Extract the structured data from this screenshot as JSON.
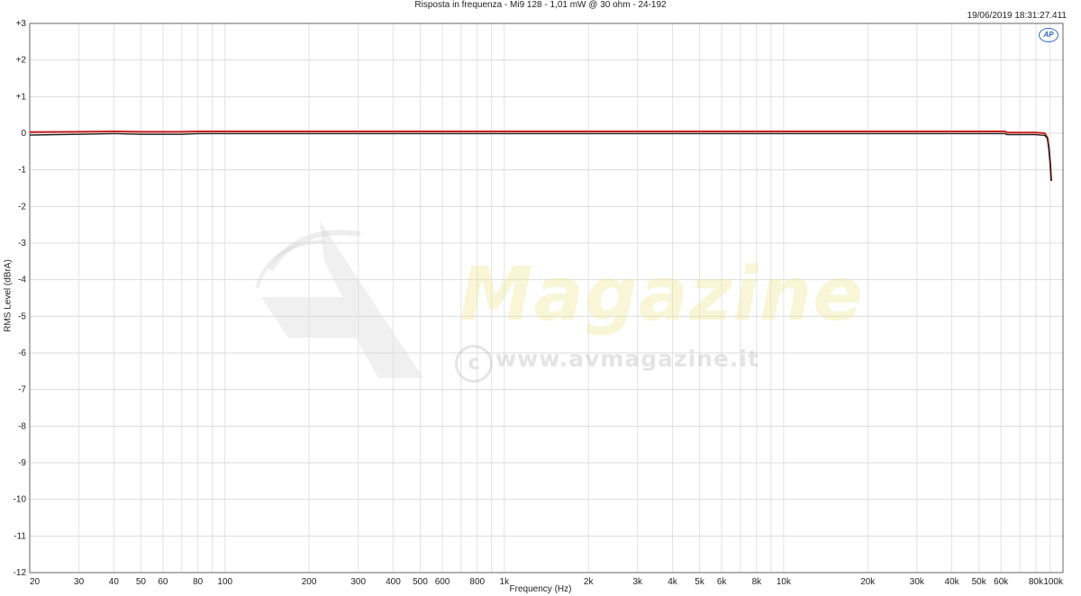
{
  "chart_data": {
    "type": "line",
    "title": "Risposta in frequenza - Mi9 128 - 1,01 mW @ 30 ohm - 24-192",
    "timestamp": "19/06/2019 18:31:27.411",
    "xlabel": "Frequency (Hz)",
    "ylabel": "RMS Level (dBrA)",
    "x_scale": "log",
    "xlim": [
      20,
      100000
    ],
    "ylim": [
      -12,
      3
    ],
    "grid": true,
    "x_ticks": [
      20,
      30,
      40,
      50,
      60,
      80,
      100,
      200,
      300,
      400,
      500,
      600,
      800,
      1000,
      2000,
      3000,
      4000,
      5000,
      6000,
      8000,
      10000,
      20000,
      30000,
      40000,
      50000,
      60000,
      80000,
      100000
    ],
    "x_tick_labels": [
      "20",
      "30",
      "40",
      "50",
      "60",
      "80",
      "100",
      "200",
      "300",
      "400",
      "500",
      "600",
      "800",
      "1k",
      "2k",
      "3k",
      "4k",
      "5k",
      "6k",
      "8k",
      "10k",
      "20k",
      "30k",
      "40k",
      "50k",
      "60k",
      "80k",
      "100k"
    ],
    "y_ticks": [
      3,
      2,
      1,
      0,
      -1,
      -2,
      -3,
      -4,
      -5,
      -6,
      -7,
      -8,
      -9,
      -10,
      -11,
      -12
    ],
    "y_tick_labels": [
      "+3",
      "+2",
      "+1",
      "0",
      "-1",
      "-2",
      "-3",
      "-4",
      "-5",
      "-6",
      "-7",
      "-8",
      "-9",
      "-10",
      "-11",
      "-12"
    ],
    "series": [
      {
        "color": "#c81e1e",
        "points": [
          [
            20,
            0.03
          ],
          [
            30,
            0.04
          ],
          [
            40,
            0.05
          ],
          [
            50,
            0.04
          ],
          [
            70,
            0.04
          ],
          [
            80,
            0.05
          ],
          [
            200,
            0.05
          ],
          [
            1000,
            0.05
          ],
          [
            10000,
            0.05
          ],
          [
            40000,
            0.05
          ],
          [
            62000,
            0.05
          ],
          [
            63000,
            0.02
          ],
          [
            80000,
            0.02
          ],
          [
            86000,
            0.0
          ],
          [
            88000,
            -0.12
          ],
          [
            89000,
            -0.4
          ],
          [
            90000,
            -0.8
          ],
          [
            90800,
            -1.3
          ]
        ]
      },
      {
        "color": "#222222",
        "points": [
          [
            20,
            -0.05
          ],
          [
            30,
            -0.03
          ],
          [
            40,
            -0.01
          ],
          [
            50,
            -0.03
          ],
          [
            70,
            -0.03
          ],
          [
            80,
            -0.01
          ],
          [
            200,
            -0.01
          ],
          [
            1000,
            -0.01
          ],
          [
            10000,
            -0.01
          ],
          [
            40000,
            -0.01
          ],
          [
            62000,
            -0.01
          ],
          [
            63000,
            -0.04
          ],
          [
            80000,
            -0.04
          ],
          [
            86000,
            -0.06
          ],
          [
            88000,
            -0.15
          ],
          [
            89000,
            -0.4
          ],
          [
            90000,
            -0.8
          ],
          [
            90800,
            -1.3
          ]
        ]
      }
    ]
  },
  "watermark": {
    "logo_text": "Magazine",
    "url": "www.avmagazine.it",
    "copyright_symbol": "c"
  },
  "badge": {
    "text": "AP"
  }
}
